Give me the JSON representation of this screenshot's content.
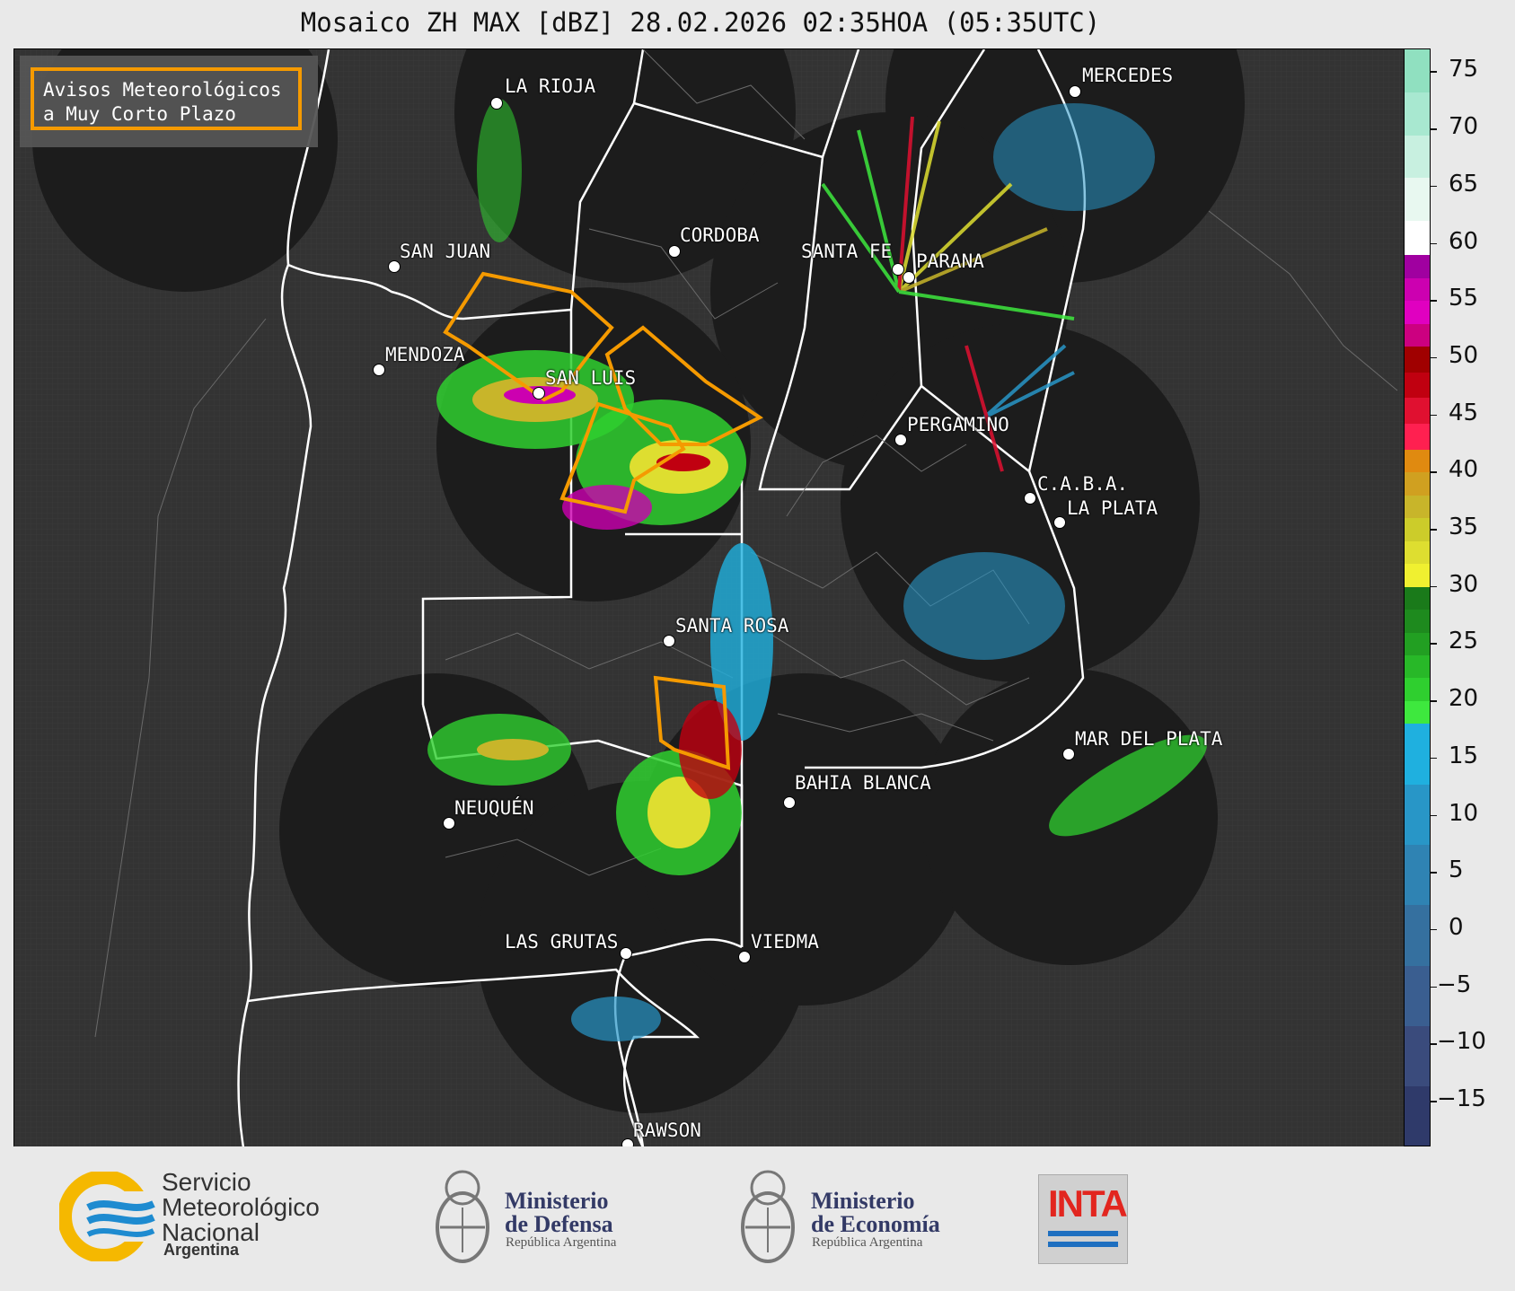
{
  "title": "Mosaico ZH MAX [dBZ] 28.02.2026 02:35HOA (05:35UTC)",
  "legend": {
    "text": "Avisos Meteorológicos\na Muy Corto Plazo",
    "border_color": "#f59a00"
  },
  "cities": [
    {
      "name": "LA RIOJA"
    },
    {
      "name": "SAN JUAN"
    },
    {
      "name": "CORDOBA"
    },
    {
      "name": "SANTA FE"
    },
    {
      "name": "PARANA"
    },
    {
      "name": "MERCEDES"
    },
    {
      "name": "MENDOZA"
    },
    {
      "name": "SAN LUIS"
    },
    {
      "name": "PERGAMINO"
    },
    {
      "name": "C.A.B.A."
    },
    {
      "name": "LA PLATA"
    },
    {
      "name": "SANTA ROSA"
    },
    {
      "name": "MAR DEL PLATA"
    },
    {
      "name": "BAHIA BLANCA"
    },
    {
      "name": "NEUQUÉN"
    },
    {
      "name": "LAS GRUTAS"
    },
    {
      "name": "VIEDMA"
    },
    {
      "name": "RAWSON"
    }
  ],
  "colorbar": {
    "ticks": [
      "75",
      "70",
      "65",
      "60",
      "55",
      "50",
      "45",
      "40",
      "35",
      "30",
      "25",
      "20",
      "15",
      "10",
      "5",
      "0",
      "−5",
      "−10",
      "−15"
    ],
    "range": [
      -19,
      77
    ],
    "bands": [
      {
        "from": -19,
        "to": 18,
        "colors": [
          "#2f3a6a",
          "#3a4b7c",
          "#3a5e90",
          "#35709f",
          "#2f83b3",
          "#2896c7",
          "#1fb0df"
        ]
      },
      {
        "from": 18,
        "to": 30,
        "colors": [
          "#3ee83e",
          "#2fcf2f",
          "#28b828",
          "#229f22",
          "#1e8a1e",
          "#1a7a1a"
        ]
      },
      {
        "from": 30,
        "to": 42,
        "colors": [
          "#f0f030",
          "#dede30",
          "#cccc2a",
          "#c8b52a",
          "#d0a020",
          "#e08a10"
        ]
      },
      {
        "from": 42,
        "to": 51,
        "colors": [
          "#ff2050",
          "#e01030",
          "#c00010",
          "#a00000"
        ]
      },
      {
        "from": 51,
        "to": 59,
        "colors": [
          "#cc0080",
          "#e000c0",
          "#cc00b0",
          "#a000a0"
        ]
      },
      {
        "from": 59,
        "to": 62,
        "colors": [
          "#ffffff"
        ]
      },
      {
        "from": 62,
        "to": 77,
        "colors": [
          "#e8f8f0",
          "#c8f0e0",
          "#a8e8d0",
          "#90e0c0"
        ]
      }
    ]
  },
  "logos": {
    "smn_line1": "Servicio",
    "smn_line2": "Meteorológico",
    "smn_line3": "Nacional",
    "smn_country": "Argentina",
    "defensa_line1": "Ministerio",
    "defensa_line2": "de Defensa",
    "defensa_sub": "República Argentina",
    "economia_line1": "Ministerio",
    "economia_line2": "de Economía",
    "economia_sub": "República Argentina",
    "inta": "INTA"
  }
}
